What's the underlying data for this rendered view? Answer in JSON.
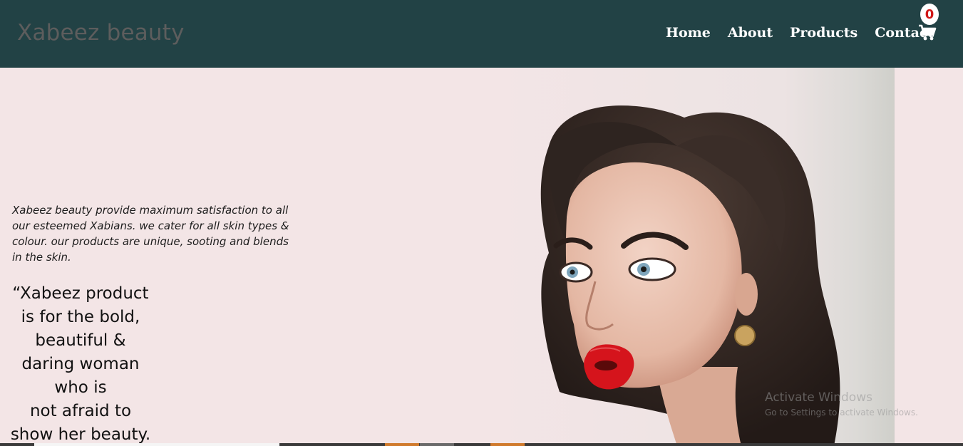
{
  "header": {
    "brand": "Xabeez beauty",
    "nav": [
      "Home",
      "About",
      "Products",
      "Contact"
    ],
    "cart_count": "0",
    "cart_icon": "shopping-cart-icon"
  },
  "hero": {
    "description": "Xabeez beauty provide maximum satisfaction to all our esteemed Xabians. we cater for all skin types & colour. our products are unique, sooting and blends in the skin.",
    "quote": "“Xabeez product\nis for the bold,\nbeautiful &\ndaring woman\nwho is\nnot afraid to\nshow her beauty."
  },
  "watermark": {
    "title": "Activate Windows",
    "subtitle": "Go to Settings to activate Windows."
  },
  "colors": {
    "header_bg": "#224245",
    "page_bg": "#f3e5e6",
    "badge_text": "#d01818"
  }
}
